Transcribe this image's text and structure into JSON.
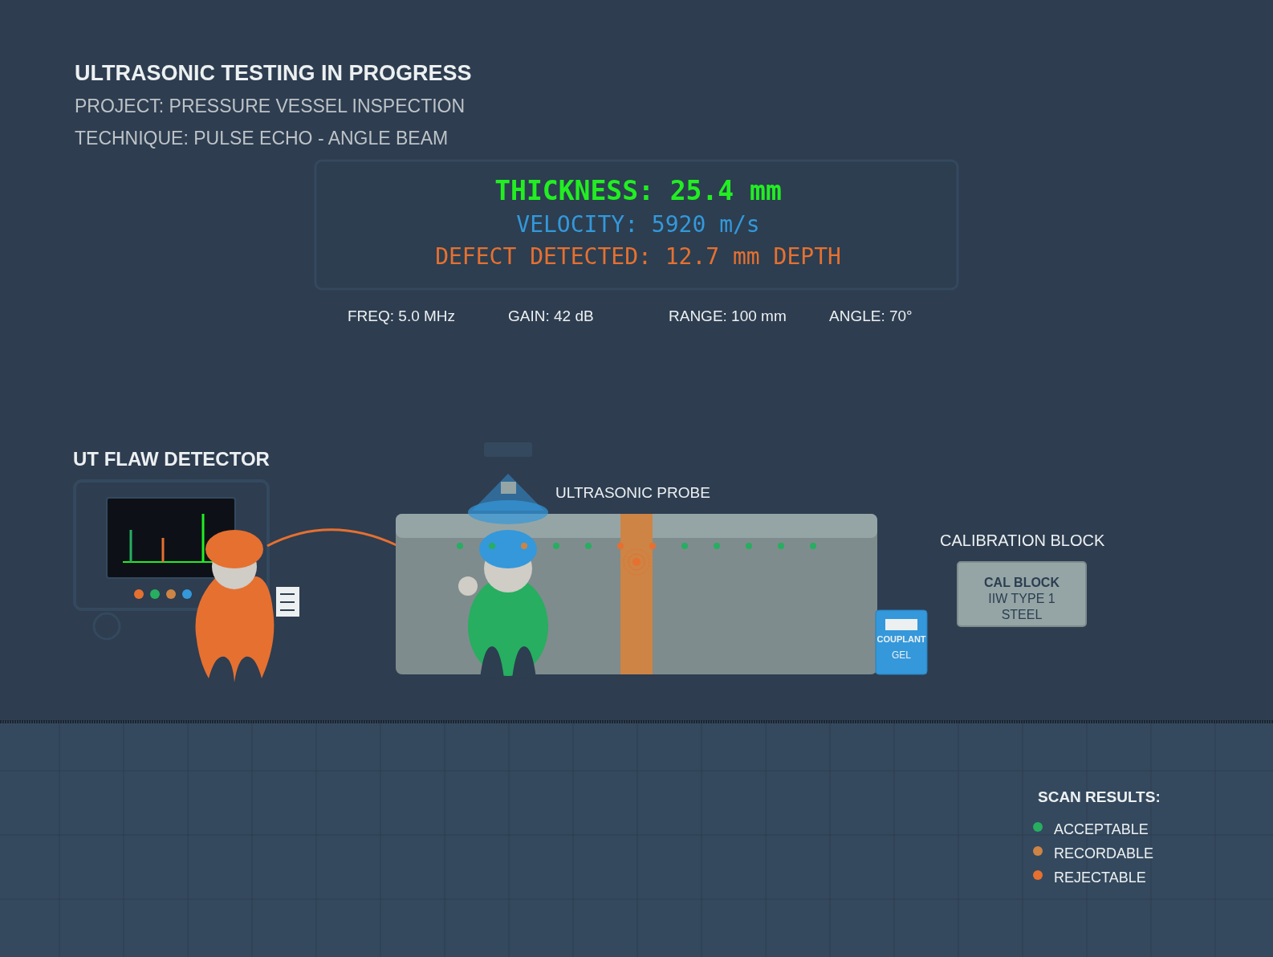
{
  "header": {
    "title": "ULTRASONIC TESTING IN PROGRESS",
    "project": "PROJECT: PRESSURE VESSEL INSPECTION",
    "technique": "TECHNIQUE: PULSE ECHO - ANGLE BEAM"
  },
  "display": {
    "lines": [
      {
        "kind": "thickness",
        "text": "THICKNESS: 25.4 mm"
      },
      {
        "kind": "velocity",
        "text": "VELOCITY: 5920 m/s"
      },
      {
        "kind": "defect",
        "text": "DEFECT DETECTED: 12.7 mm DEPTH"
      }
    ]
  },
  "parameters": [
    "FREQ: 5.0 MHz",
    "GAIN: 42 dB",
    "RANGE: 100 mm",
    "ANGLE: 70°"
  ],
  "detector": {
    "label": "UT FLAW DETECTOR"
  },
  "probe": {
    "label": "ULTRASONIC PROBE"
  },
  "weld_indications": [
    {
      "color": "#27ae60"
    },
    {
      "color": "#27ae60"
    },
    {
      "color": "#cd8445"
    },
    {
      "color": "#27ae60"
    },
    {
      "color": "#27ae60"
    },
    {
      "color": "#e67030"
    },
    {
      "color": "#e67030"
    },
    {
      "color": "#27ae60"
    },
    {
      "color": "#27ae60"
    },
    {
      "color": "#27ae60"
    },
    {
      "color": "#27ae60"
    },
    {
      "color": "#27ae60"
    }
  ],
  "couplant": {
    "title": "COUPLANT",
    "subtitle": "GEL"
  },
  "calibration": {
    "label": "CALIBRATION BLOCK",
    "block_lines": [
      "CAL BLOCK",
      "IIW TYPE 1",
      "STEEL"
    ]
  },
  "legend": {
    "title": "SCAN RESULTS:",
    "items": [
      {
        "label": "ACCEPTABLE",
        "color": "#27ae60"
      },
      {
        "label": "RECORDABLE",
        "color": "#cd8445"
      },
      {
        "label": "REJECTABLE",
        "color": "#e67030"
      }
    ]
  }
}
